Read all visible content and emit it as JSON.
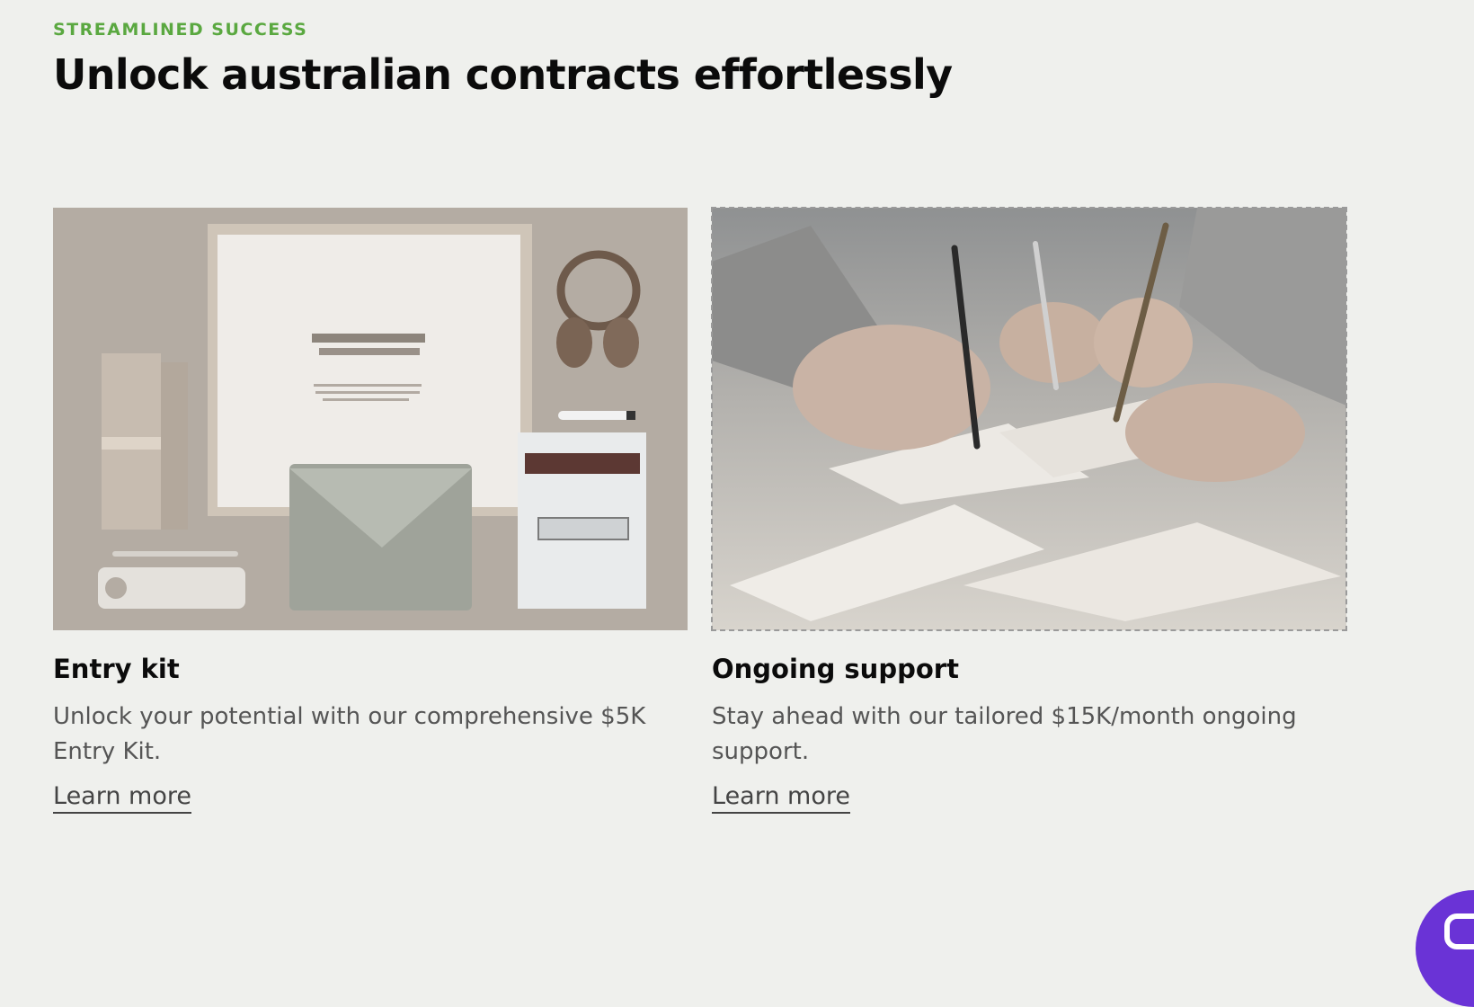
{
  "section": {
    "eyebrow": "STREAMLINED SUCCESS",
    "headline": "Unlock australian contracts effortlessly"
  },
  "cards": [
    {
      "image_alt": "Stationery mockup kit with framed document, headphones, envelope and cards",
      "title": "Entry kit",
      "description": "Unlock your potential with our comprehensive $5K Entry Kit.",
      "link_label": "Learn more"
    },
    {
      "image_alt": "Hands signing papers with pens on a table",
      "title": "Ongoing support",
      "description": "Stay ahead with our tailored $15K/month ongoing support.",
      "link_label": "Learn more"
    }
  ],
  "chat_widget": {
    "icon": "chat-icon",
    "color": "#6a33d6"
  },
  "colors": {
    "background": "#eff0ed",
    "eyebrow": "#5aa840",
    "heading": "#0b0b0b",
    "body_text": "#555555"
  }
}
